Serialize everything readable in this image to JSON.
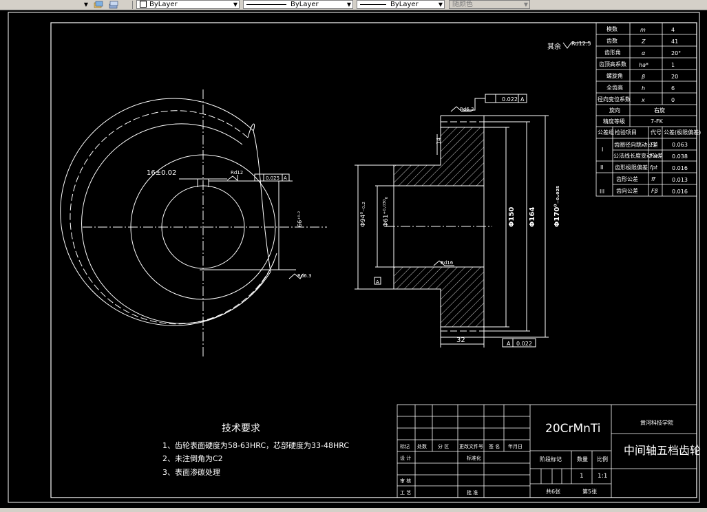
{
  "toolbar": {
    "layer_combo": "ByLayer",
    "linetype_combo": "ByLayer",
    "lineweight_combo": "ByLayer",
    "color_combo": "随颜色"
  },
  "drawing": {
    "roughness_other": "其余",
    "roughness_other_value": "Rd12.5",
    "dim_keyway_width": "16±0.02",
    "roughness_rd12": "Rd12",
    "flatness_tol": "0.025",
    "datum_a": "A",
    "dim_keyway_depth": "66⁺⁰·²",
    "roughness_rd6_3": "Rd6.3",
    "runout_top": "0.022",
    "dim_14": "14",
    "dim_bore": "Φ94⁰₋₀.₂",
    "dim_hub": "Φ61⁺⁰·⁰³⁰₀",
    "dim_150": "Φ150",
    "dim_164": "Φ164",
    "dim_170": "Φ170⁰₋₀.₀₂₅",
    "roughness_rd16": "Rd16",
    "dim_32": "32",
    "runout_bottom": "0.022"
  },
  "params_table": {
    "rows": [
      {
        "label": "模数",
        "sym": "m",
        "val": "4"
      },
      {
        "label": "齿数",
        "sym": "Z",
        "val": "41"
      },
      {
        "label": "齿形角",
        "sym": "α",
        "val": "20°"
      },
      {
        "label": "齿顶高系数",
        "sym": "ha*",
        "val": "1"
      },
      {
        "label": "螺旋角",
        "sym": "β",
        "val": "20"
      },
      {
        "label": "全齿高",
        "sym": "h",
        "val": "6"
      },
      {
        "label": "径向变位系数",
        "sym": "x",
        "val": "0"
      }
    ],
    "direction_label": "旋向",
    "direction_val": "右旋",
    "accuracy_label": "精度等级",
    "accuracy_val": "7-FK",
    "header": {
      "group": "公差组",
      "item": "检验项目",
      "code": "代号",
      "value": "公差(极限偏差)"
    },
    "tol_rows": [
      {
        "group": "I",
        "item": "齿圈径向跳动公差",
        "code": "Fr",
        "val": "0.063"
      },
      {
        "group": "",
        "item": "公法线长度变动公差",
        "code": "Fw",
        "val": "0.038"
      },
      {
        "group": "II",
        "item": "齿形极限偏差",
        "code": "fpt",
        "val": "0.016"
      },
      {
        "group": "",
        "item": "齿形公差",
        "code": "ff",
        "val": "0.013"
      },
      {
        "group": "III",
        "item": "齿向公差",
        "code": "Fβ",
        "val": "0.016"
      }
    ]
  },
  "tech_req": {
    "title": "技术要求",
    "items": [
      "1、齿轮表面硬度为58-63HRC，芯部硬度为33-48HRC",
      "2、未注倒角为C2",
      "3、表面渗碳处理"
    ]
  },
  "title_block": {
    "material": "20CrMnTi",
    "school": "黄河科技学院",
    "part_name": "中间轴五档齿轮",
    "h_mark": "标记",
    "h_qty": "处数",
    "h_zone": "分 区",
    "h_docno": "更改文件号",
    "h_sign": "签 名",
    "h_date": "年月日",
    "design": "设 计",
    "standardize": "标准化",
    "review": "审 核",
    "process": "工 艺",
    "approve": "批 准",
    "stage_label": "阶段标记",
    "weight_label": "数量",
    "scale_label": "比例",
    "qty": "1",
    "scale": "1:1",
    "sheets_total": "共6张",
    "sheet_no": "第5张"
  }
}
